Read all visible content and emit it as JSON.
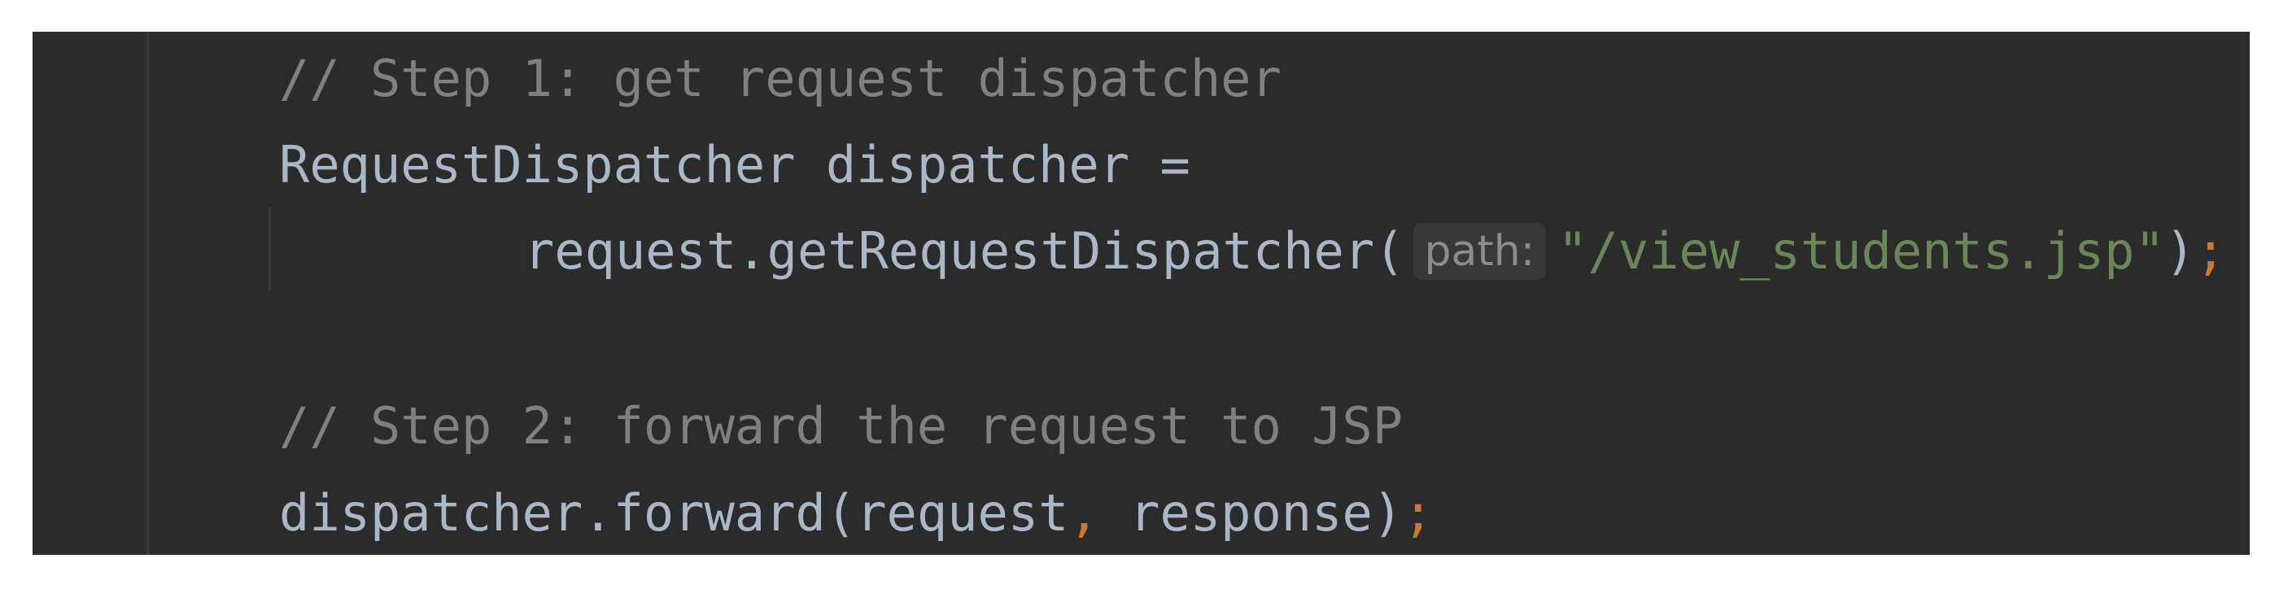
{
  "editor": {
    "lines": {
      "comment_step1": "// Step 1: get request dispatcher",
      "declaration_type": "RequestDispatcher",
      "declaration_rest": " dispatcher =",
      "call_prefix": "request.getRequestDispatcher(",
      "param_hint": "path:",
      "string_literal": "\"/view_students.jsp\"",
      "call_close": ")",
      "call_semicolon": ";",
      "comment_step2": "// Step 2: forward the request to JSP",
      "forward_prefix": "dispatcher.forward(request",
      "forward_comma": ",",
      "forward_rest": " response)",
      "forward_semicolon": ";"
    },
    "colors": {
      "background": "#2b2b2b",
      "default_text": "#a9b7c6",
      "comment": "#808080",
      "string": "#6a8759",
      "punctuation": "#cc7832"
    }
  }
}
